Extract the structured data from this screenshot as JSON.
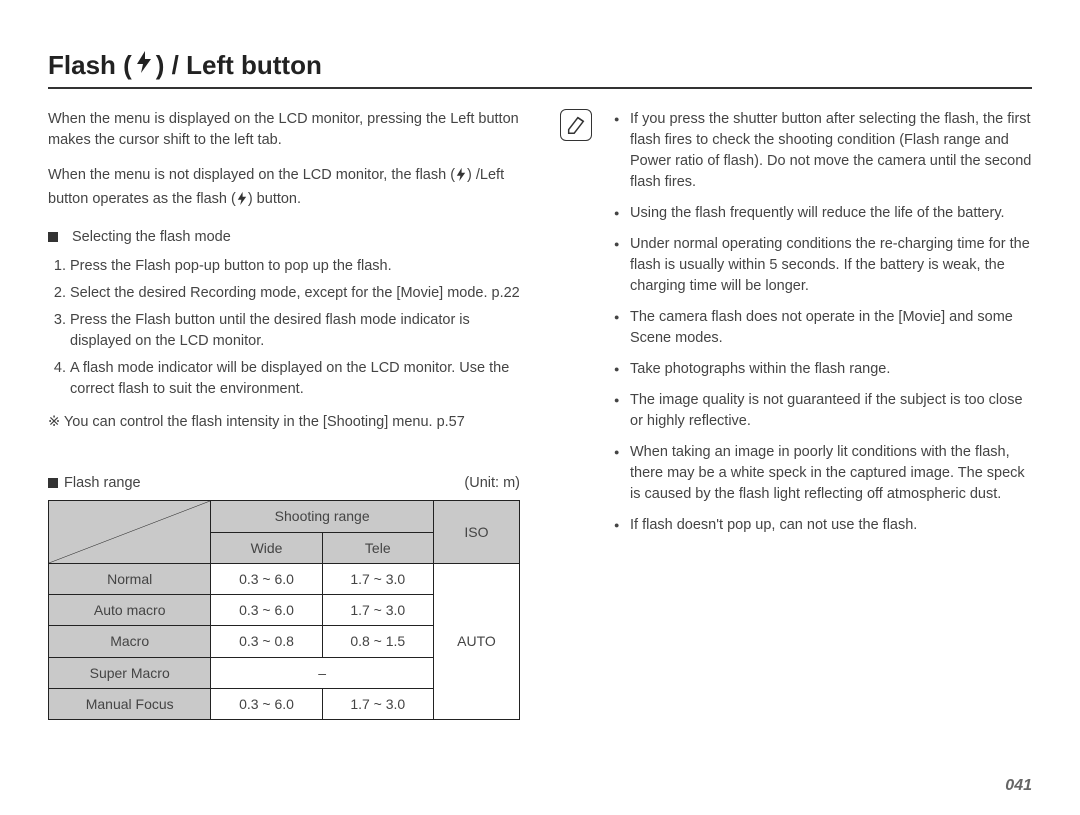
{
  "title_prefix": "Flash (",
  "title_suffix": ") / Left button",
  "intro1": "When the menu is displayed on the LCD monitor, pressing the Left button makes the cursor shift to the left tab.",
  "intro2a": "When the menu is not displayed on the LCD monitor, the flash (",
  "intro2b": ") /Left button operates as the flash (",
  "intro2c": ") button.",
  "select_heading": "Selecting the flash mode",
  "steps": [
    "Press the Flash pop-up button to pop up the flash.",
    "Select the desired Recording mode, except for the [Movie] mode. p.22",
    "Press the Flash button until the desired flash mode indicator is displayed on the LCD monitor.",
    "A flash mode indicator will be displayed on the LCD monitor. Use the correct flash to suit the environment."
  ],
  "flash_note": "※ You can control the flash intensity in the [Shooting] menu. p.57",
  "range_heading": "Flash range",
  "range_unit": "(Unit: m)",
  "table": {
    "col_shooting": "Shooting range",
    "col_wide": "Wide",
    "col_tele": "Tele",
    "col_iso": "ISO",
    "iso_value": "AUTO",
    "rows": [
      {
        "label": "Normal",
        "wide": "0.3 ~ 6.0",
        "tele": "1.7 ~ 3.0"
      },
      {
        "label": "Auto macro",
        "wide": "0.3 ~ 6.0",
        "tele": "1.7 ~ 3.0"
      },
      {
        "label": "Macro",
        "wide": "0.3 ~ 0.8",
        "tele": "0.8 ~ 1.5"
      },
      {
        "label": "Super Macro",
        "wide": "–",
        "tele": ""
      },
      {
        "label": "Manual Focus",
        "wide": "0.3 ~ 6.0",
        "tele": "1.7 ~ 3.0"
      }
    ]
  },
  "tips": [
    "If you press the shutter button after selecting the flash, the first flash fires to check the shooting condition (Flash range and Power ratio of flash). Do not move the camera until the second flash fires.",
    "Using the flash frequently will reduce the life of the battery.",
    "Under normal operating conditions the re-charging time for the flash is usually within 5 seconds. If the battery is weak, the charging time will be longer.",
    "The camera flash does not operate in the [Movie] and some Scene modes.",
    "Take photographs within the flash range.",
    "The image quality is not guaranteed if the subject is too close or highly reflective.",
    "When taking an image in poorly lit conditions with the flash, there may be a white speck in the captured image. The speck is caused by the flash light reflecting off atmospheric dust.",
    "If flash doesn't pop up, can not use the flash."
  ],
  "page_number": "041"
}
